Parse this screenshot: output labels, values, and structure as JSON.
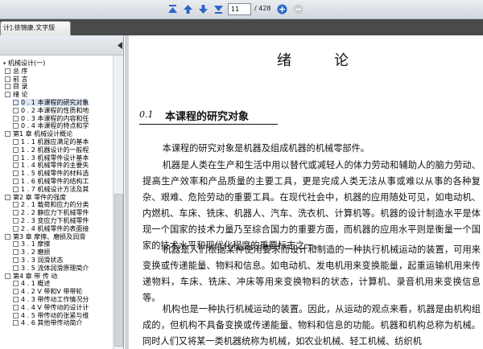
{
  "toolbar": {
    "page_current": "11",
    "page_total": "/ 428",
    "buttons": [
      "first-page-icon",
      "previous-page-icon",
      "next-page-icon",
      "last-page-icon",
      "zoom-in-icon",
      "zoom-out-icon"
    ]
  },
  "tab": {
    "label": "计].徐锦康.文字版"
  },
  "toc": [
    {
      "label": "机械设计(一)",
      "level": 0,
      "check": false
    },
    {
      "label": "总  序",
      "level": 1,
      "check": true
    },
    {
      "label": "前  言",
      "level": 1,
      "check": true
    },
    {
      "label": "目  录",
      "level": 1,
      "check": true
    },
    {
      "label": "绪  论",
      "level": 1,
      "check": true
    },
    {
      "label": "0 . 1  本课程的研究对象",
      "level": 2,
      "check": true,
      "selected": true
    },
    {
      "label": "0 . 2  本课程的性质和地",
      "level": 2,
      "check": true
    },
    {
      "label": "0 . 3  本课程的内容和任",
      "level": 2,
      "check": true
    },
    {
      "label": "0 . 4  本课程的特点和学",
      "level": 2,
      "check": true
    },
    {
      "label": "第1 章  机械设计概论",
      "level": 1,
      "check": true
    },
    {
      "label": "1 . 1  机器应满足的基本",
      "level": 2,
      "check": true
    },
    {
      "label": "1 . 2  机器设计的一般程",
      "level": 2,
      "check": true
    },
    {
      "label": "1 . 3  机械零件设计基本",
      "level": 2,
      "check": true
    },
    {
      "label": "1 . 4  机械零件的主要失",
      "level": 2,
      "check": true
    },
    {
      "label": "1 . 5  机械零件的材料选",
      "level": 2,
      "check": true
    },
    {
      "label": "1 . 6  机械零件的结构工",
      "level": 2,
      "check": true
    },
    {
      "label": "1 . 7  机械设计方法及其",
      "level": 2,
      "check": true
    },
    {
      "label": "第2 章  零件的强度",
      "level": 1,
      "check": true
    },
    {
      "label": "2 . 1  载荷和应力的分类",
      "level": 2,
      "check": true
    },
    {
      "label": "2 . 2  静应力下机械零件",
      "level": 2,
      "check": true
    },
    {
      "label": "2 . 3  变应力下机械零件",
      "level": 2,
      "check": true
    },
    {
      "label": "2 . 4  机械零件的表面接",
      "level": 2,
      "check": true
    },
    {
      "label": "第3 章  摩擦、磨损及润滑",
      "level": 1,
      "check": true
    },
    {
      "label": "3 . 1  摩擦",
      "level": 2,
      "check": true
    },
    {
      "label": "3 . 2  磨损",
      "level": 2,
      "check": true
    },
    {
      "label": "3 . 3  润滑状态",
      "level": 2,
      "check": true
    },
    {
      "label": "3 . 5  流体润滑原理简介",
      "level": 2,
      "check": true
    },
    {
      "label": "第4 章  带  传  动",
      "level": 1,
      "check": true
    },
    {
      "label": "4 . 1  概述",
      "level": 2,
      "check": true
    },
    {
      "label": "4 . 2  V 带和V 带带轮",
      "level": 2,
      "check": true
    },
    {
      "label": "4 . 3  带传动工作情况分",
      "level": 2,
      "check": true
    },
    {
      "label": "4 . 4  V 带传动的设计计",
      "level": 2,
      "check": true
    },
    {
      "label": "4 . 5  带传动的张紧与维",
      "level": 2,
      "check": true
    },
    {
      "label": "4 . 6  其他带传动简介",
      "level": 2,
      "check": true
    }
  ],
  "document": {
    "chapter_title_a": "绪",
    "chapter_title_b": "论",
    "section_number": "0.1",
    "section_title": "本课程的研究对象",
    "paragraphs": [
      "本课程的研究对象是机器及组成机器的机械零部件。",
      "机器是人类在生产和生活中用以替代或减轻人的体力劳动和辅助人的脑力劳动、提高生产效率和产品质量的主要工具，更是完成人类无法从事或难以从事的各种复杂、艰难、危险劳动的重要工具。在现代社会中，机器的应用随处可见，如电动机、内燃机、车床、铣床、机器人、汽车、洗衣机、计算机等。机器的设计制造水平是体现一个国家的技术力量乃至综合国力的重要方面，而机器的应用水平则是衡量一个国家的技术水平和现代化程度的重要标志之一。",
      "机器是人们根据某种使用要求而设计和制造的一种执行机械运动的装置，可用来变换或传递能量、物料和信息。如电动机、发电机用来变换能量，起重运输机用来传递物料，车床、铣床、冲床等用来变换物料的状态，计算机、录音机用来变换信息等。",
      "机构也是一种执行机械运动的装置。因此，从运动的观点来看，机器是由机构组成的，但机构不具备变换或传递能量、物料和信息的功能。机器和机构总称为机械。同时人们又将某一类机器统称为机械，如农业机械、轻工机械、纺织机"
    ]
  }
}
